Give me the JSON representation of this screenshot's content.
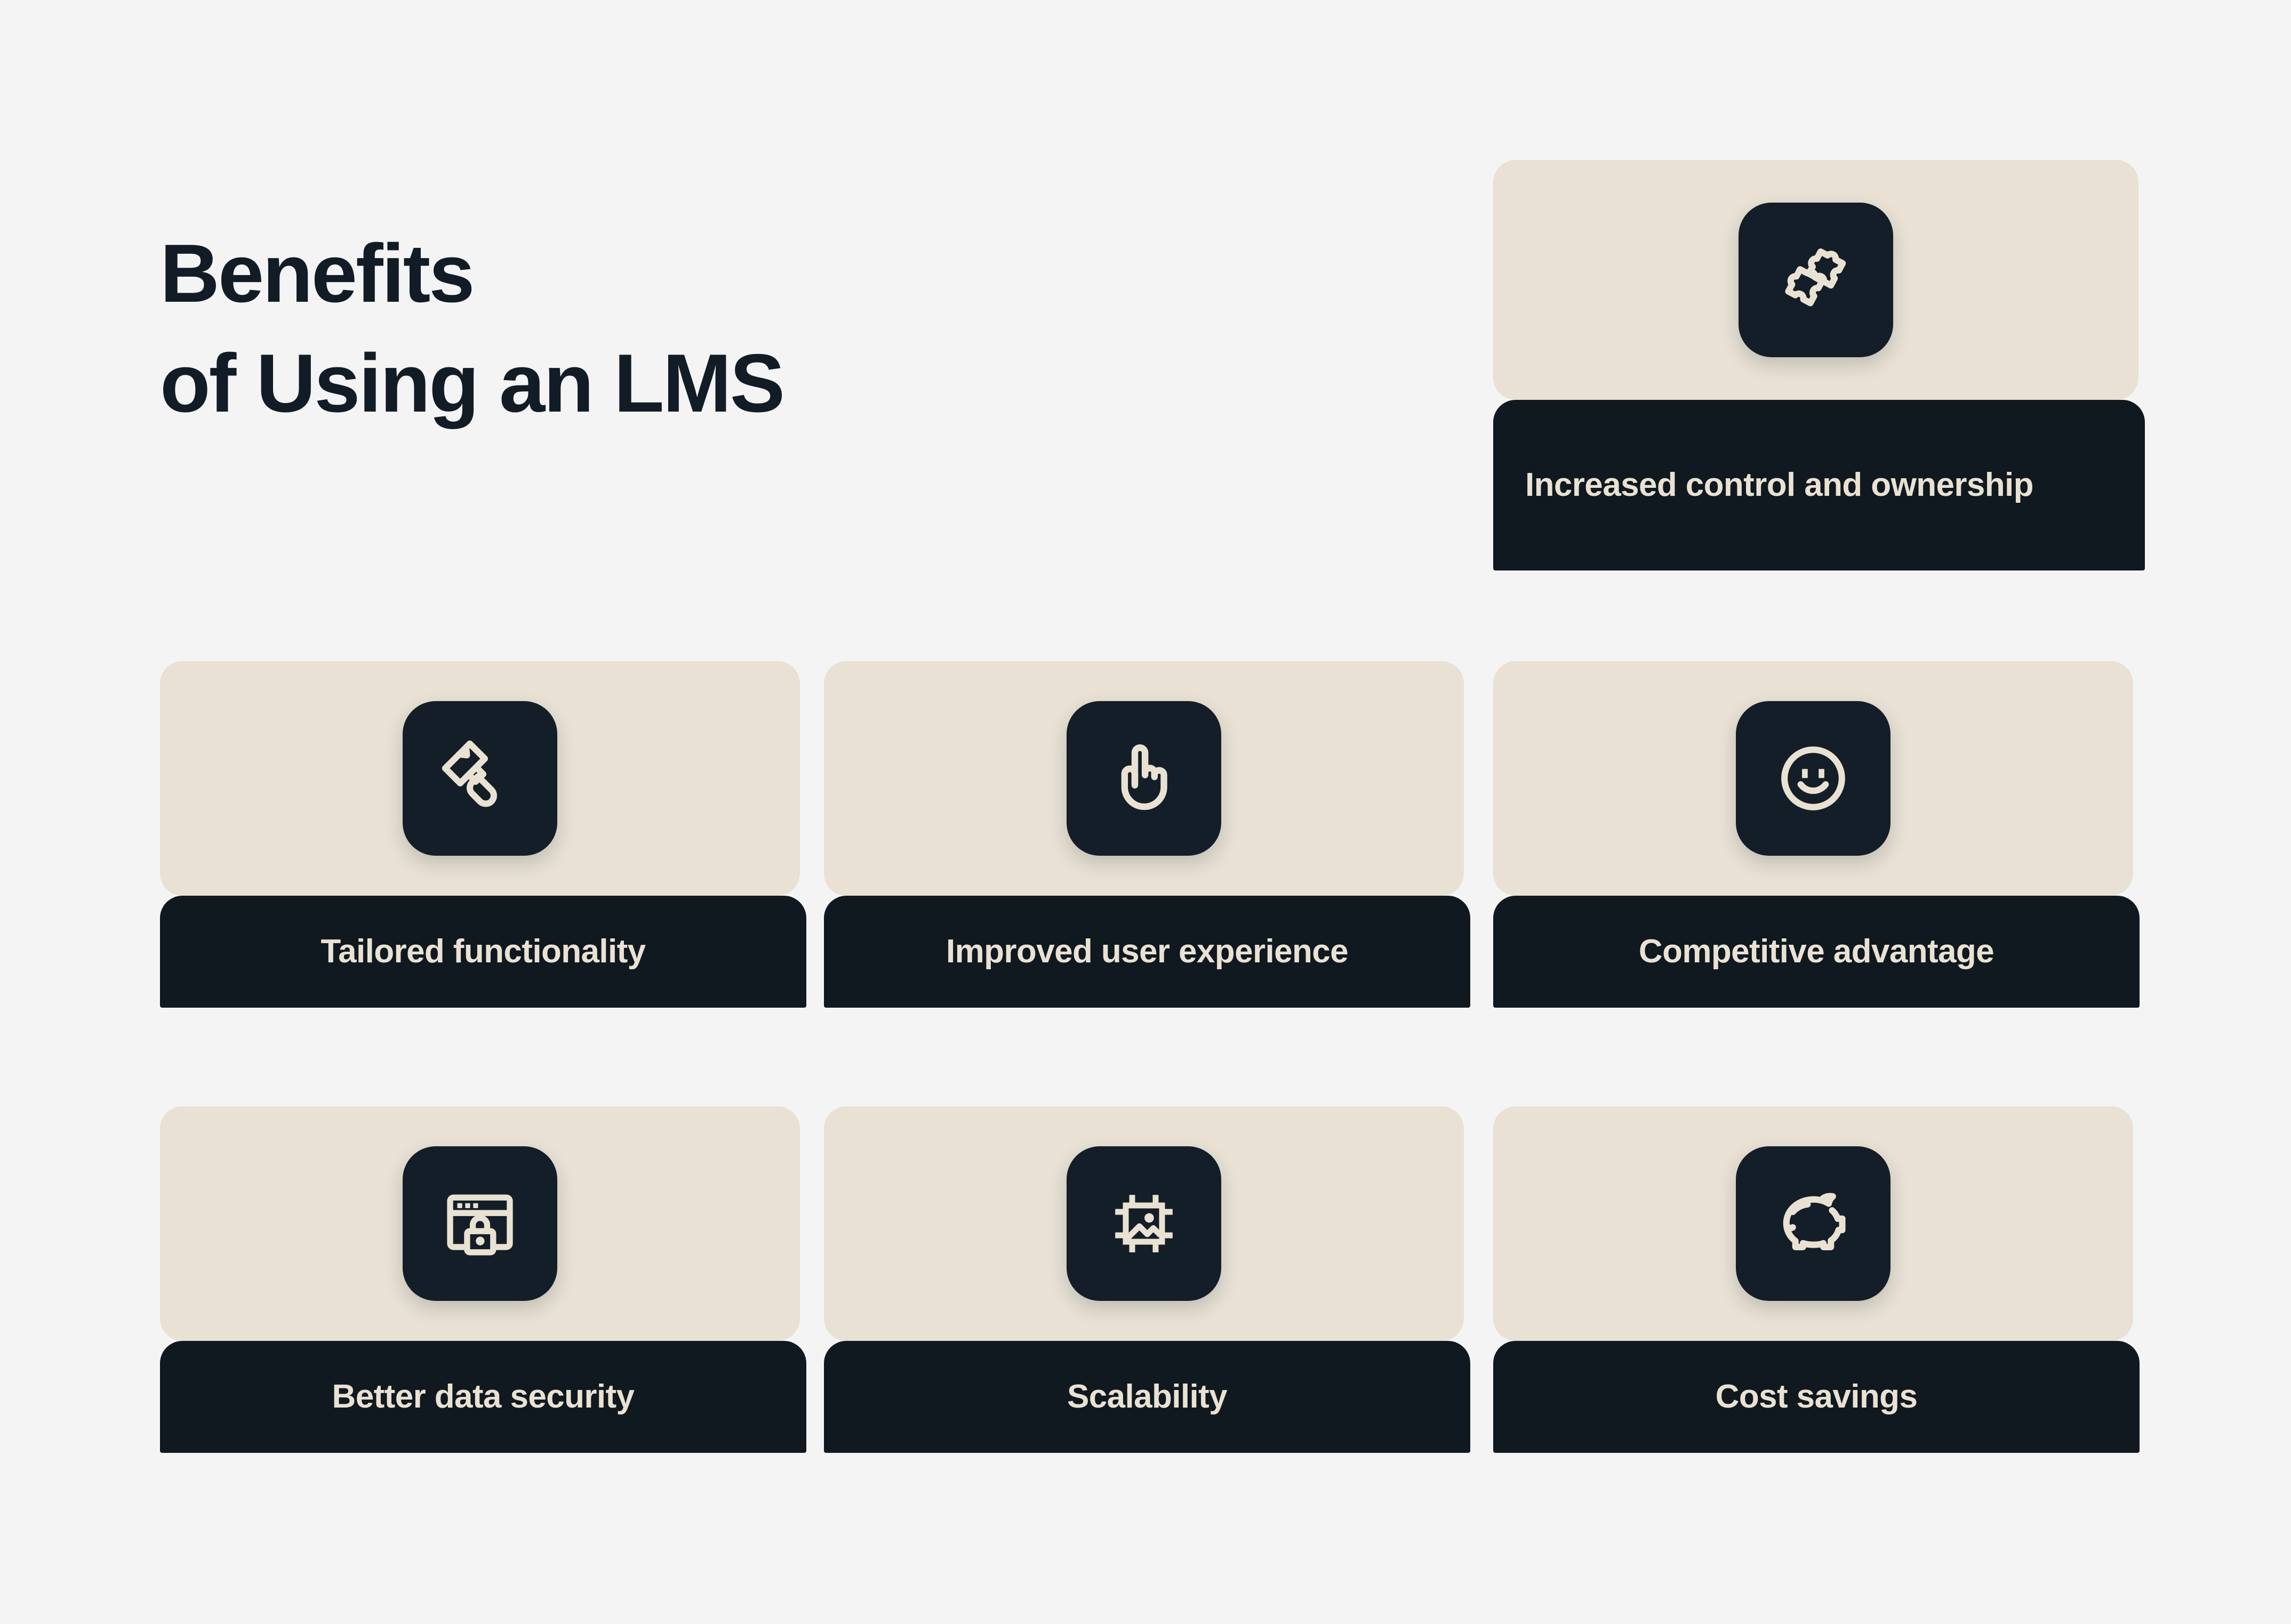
{
  "theme": {
    "page_background": "#F4F4F4",
    "card_background": "#E8E1D4",
    "panel_background": "#101820",
    "icon_tile_background": "#141E28",
    "label_text_color": "#E9E2D3",
    "title_color": "#121C26"
  },
  "title": {
    "line1": "Benefits",
    "line2": "of Using an LMS"
  },
  "cards": [
    {
      "id": "increased-control-and-ownership",
      "label": "Increased control and ownership",
      "icon": "puzzle-piece-icon",
      "align": "left"
    },
    {
      "id": "tailored-functionality",
      "label": "Tailored functionality",
      "icon": "paint-brush-icon",
      "align": "center"
    },
    {
      "id": "improved-user-experience",
      "label": "Improved user experience",
      "icon": "pointing-hand-icon",
      "align": "center"
    },
    {
      "id": "competitive-advantage",
      "label": "Competitive advantage",
      "icon": "smiley-face-icon",
      "align": "center"
    },
    {
      "id": "better-data-security",
      "label": "Better data security",
      "icon": "browser-lock-icon",
      "align": "center"
    },
    {
      "id": "scalability",
      "label": "Scalability",
      "icon": "image-resize-icon",
      "align": "center"
    },
    {
      "id": "cost-savings",
      "label": "Cost savings",
      "icon": "piggy-bank-icon",
      "align": "center"
    }
  ]
}
